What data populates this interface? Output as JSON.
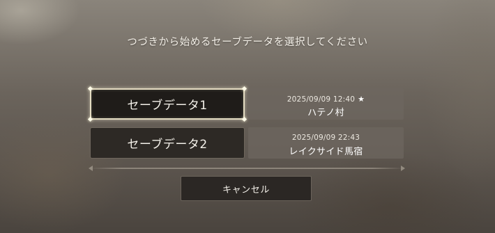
{
  "prompt": "つづきから始めるセーブデータを選択してください",
  "saves": [
    {
      "label": "セーブデータ1",
      "date": "2025/09/09 12:40",
      "star": "★",
      "location": "ハテノ村",
      "selected": true
    },
    {
      "label": "セーブデータ2",
      "date": "2025/09/09 22:43",
      "location": "レイクサイド馬宿",
      "selected": false
    }
  ],
  "cancel_label": "キャンセル",
  "colors": {
    "selected_border": "#e4dcc2",
    "button_bg": "#2d2925",
    "info_bg": "#6e675f"
  },
  "icons": {
    "star": "star-icon"
  }
}
